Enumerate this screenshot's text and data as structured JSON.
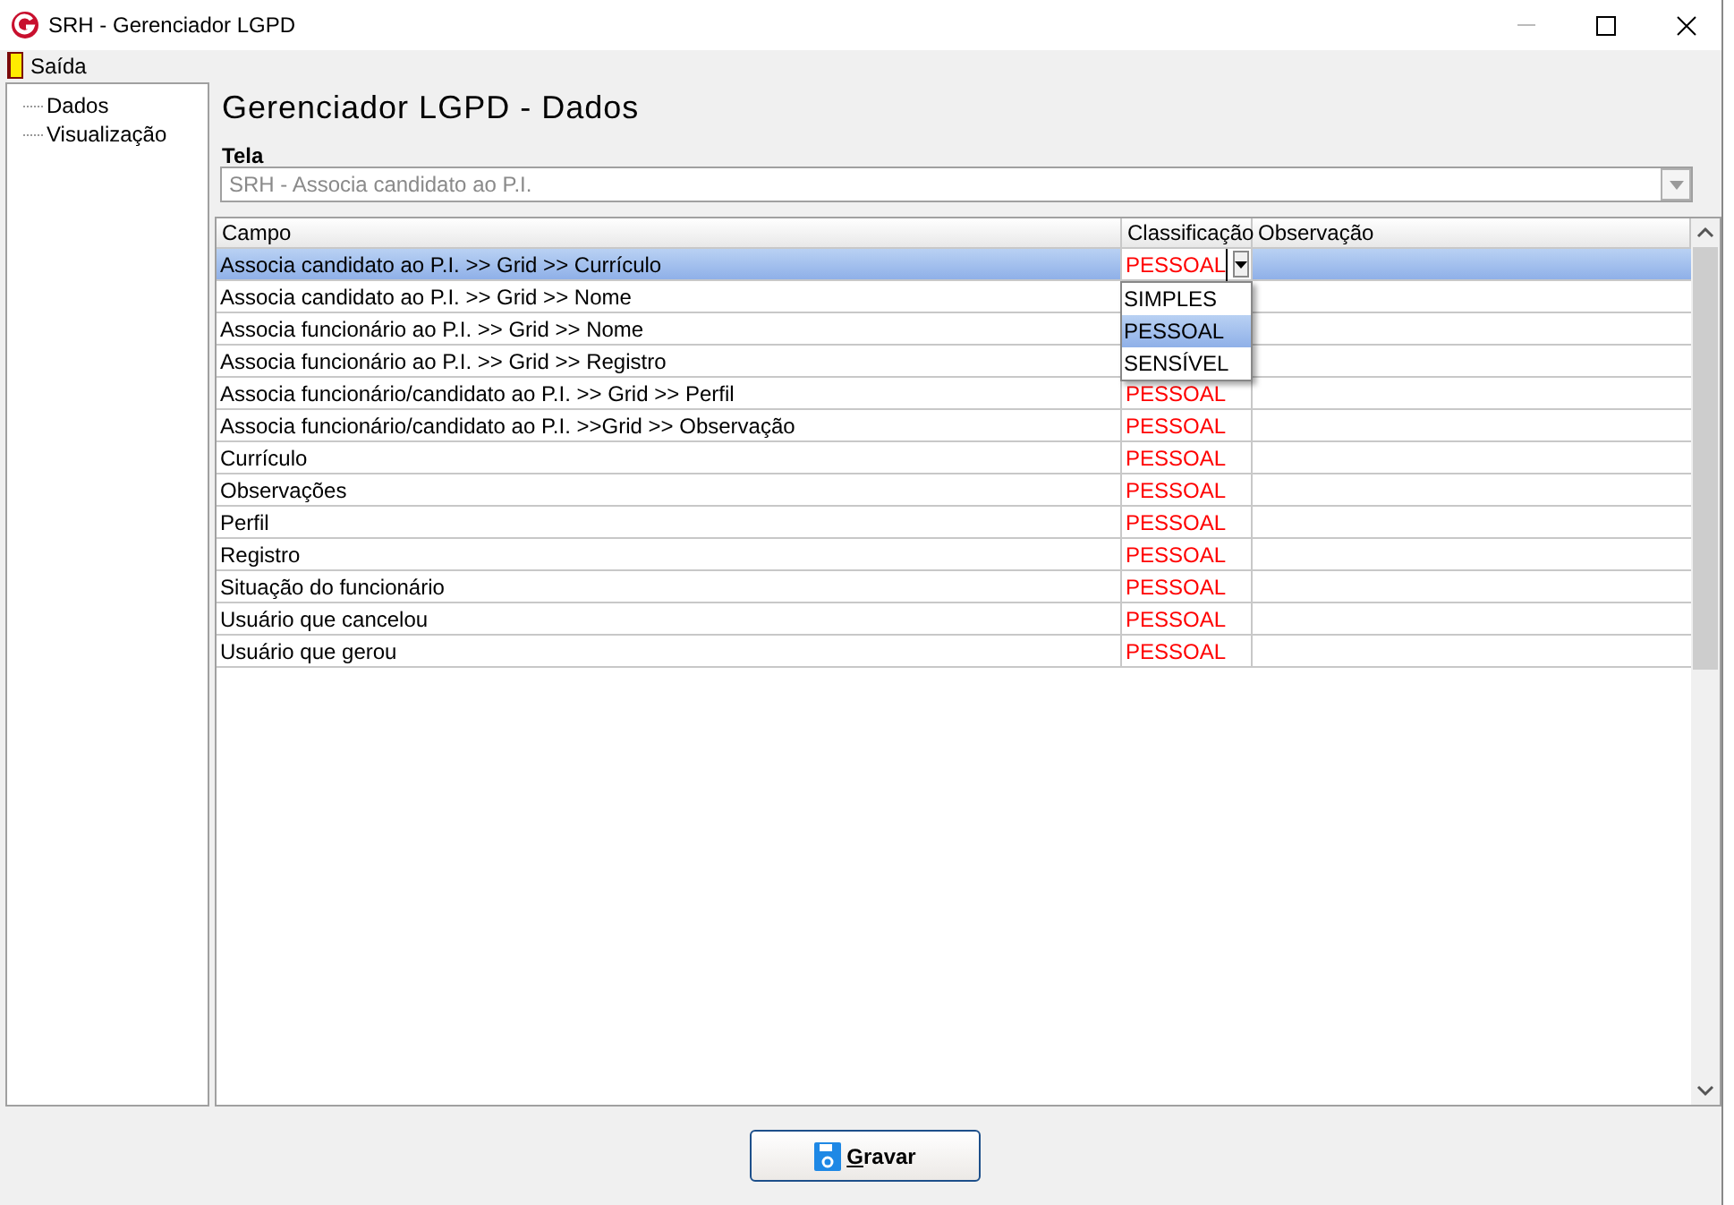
{
  "window": {
    "title": "SRH - Gerenciador LGPD"
  },
  "menu": [
    {
      "label": "Saída"
    }
  ],
  "tree": {
    "items": [
      {
        "label": "Dados"
      },
      {
        "label": "Visualização"
      }
    ]
  },
  "heading": "Gerenciador LGPD - Dados",
  "tela": {
    "label": "Tela",
    "value": "SRH - Associa candidato ao P.I.",
    "disabled": true
  },
  "table": {
    "columns": [
      "Campo",
      "Classificação",
      "Observação"
    ],
    "rows": [
      {
        "campo": "Associa candidato ao P.I. >> Grid >> Currículo",
        "classificacao": "PESSOAL",
        "selected": true,
        "editing": true
      },
      {
        "campo": "Associa candidato ao P.I. >> Grid >> Nome",
        "selected": false,
        "editing": false
      },
      {
        "campo": "Associa funcionário ao P.I. >> Grid >> Nome",
        "selected": false,
        "editing": false
      },
      {
        "campo": "Associa funcionário ao P.I. >> Grid >> Registro",
        "selected": false,
        "editing": false
      },
      {
        "campo": "Associa funcionário/candidato ao P.I. >> Grid >> Perfil",
        "classificacao": "PESSOAL",
        "selected": false,
        "editing": false
      },
      {
        "campo": "Associa funcionário/candidato ao P.I. >>Grid >> Observação",
        "classificacao": "PESSOAL",
        "selected": false,
        "editing": false
      },
      {
        "campo": "Currículo",
        "classificacao": "PESSOAL",
        "selected": false,
        "editing": false
      },
      {
        "campo": "Observações",
        "classificacao": "PESSOAL",
        "selected": false,
        "editing": false
      },
      {
        "campo": "Perfil",
        "classificacao": "PESSOAL",
        "selected": false,
        "editing": false
      },
      {
        "campo": "Registro",
        "classificacao": "PESSOAL",
        "selected": false,
        "editing": false
      },
      {
        "campo": "Situação do funcionário",
        "classificacao": "PESSOAL",
        "selected": false,
        "editing": false
      },
      {
        "campo": "Usuário que cancelou",
        "classificacao": "PESSOAL",
        "selected": false,
        "editing": false
      },
      {
        "campo": "Usuário que gerou",
        "classificacao": "PESSOAL",
        "selected": false,
        "editing": false
      }
    ],
    "dropdown": [
      {
        "label": "SIMPLES",
        "selected": false
      },
      {
        "label": "PESSOAL",
        "selected": true
      },
      {
        "label": "SENSÍVEL",
        "selected": false
      }
    ]
  },
  "buttons": [
    {
      "label": "Gravar"
    }
  ]
}
